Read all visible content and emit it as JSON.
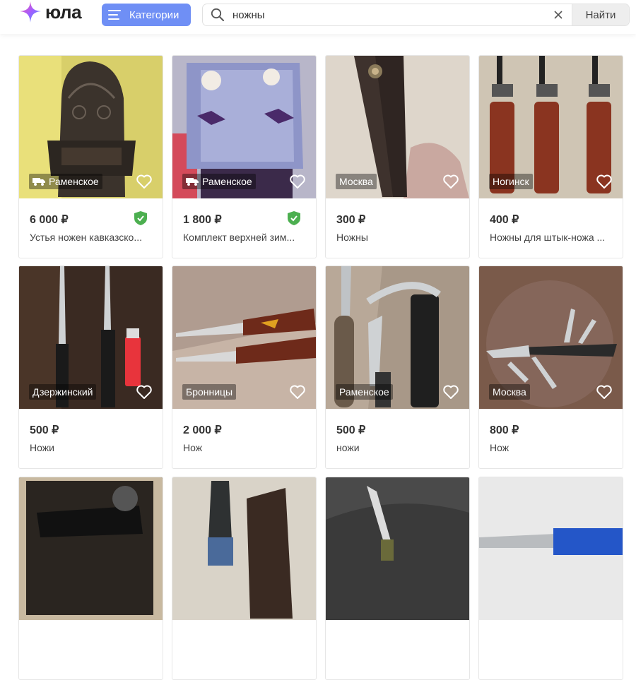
{
  "header": {
    "logo_text": "юла",
    "categories_label": "Категории",
    "search": {
      "value": "ножны",
      "placeholder": ""
    },
    "find_label": "Найти"
  },
  "listings": [
    {
      "price": "6 000 ₽",
      "title": "Устья ножен кавказско...",
      "location": "Раменское",
      "delivery": true,
      "verified": true
    },
    {
      "price": "1 800 ₽",
      "title": "Комплект верхней зим...",
      "location": "Раменское",
      "delivery": true,
      "verified": true
    },
    {
      "price": "300 ₽",
      "title": "Ножны",
      "location": "Москва",
      "delivery": false,
      "verified": false
    },
    {
      "price": "400 ₽",
      "title": "Ножны для штык-ножа ...",
      "location": "Ногинск",
      "delivery": false,
      "verified": false
    },
    {
      "price": "500 ₽",
      "title": "Ножи",
      "location": "Дзержинский",
      "delivery": false,
      "verified": false
    },
    {
      "price": "2 000 ₽",
      "title": "Нож",
      "location": "Бронницы",
      "delivery": false,
      "verified": false
    },
    {
      "price": "500 ₽",
      "title": "ножи",
      "location": "Раменское",
      "delivery": false,
      "verified": false
    },
    {
      "price": "800 ₽",
      "title": "Нож",
      "location": "Москва",
      "delivery": false,
      "verified": false
    },
    {
      "price": "",
      "title": "",
      "location": "",
      "delivery": false,
      "verified": false
    },
    {
      "price": "",
      "title": "",
      "location": "",
      "delivery": false,
      "verified": false
    },
    {
      "price": "",
      "title": "",
      "location": "",
      "delivery": false,
      "verified": false
    },
    {
      "price": "",
      "title": "",
      "location": "",
      "delivery": false,
      "verified": false
    }
  ],
  "colors": {
    "accent": "#6f8ff5",
    "verified": "#4caf50"
  }
}
